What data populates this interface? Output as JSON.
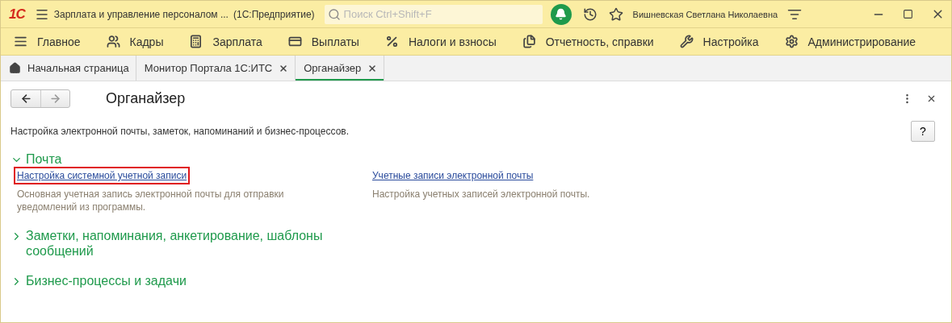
{
  "window": {
    "logo": "1С",
    "title": "Зарплата и управление персоналом ...",
    "subtitle": "(1С:Предприятие)",
    "search": {
      "placeholder": "Поиск Ctrl+Shift+F"
    },
    "user": "Вишневская Светлана Николаевна"
  },
  "sections": [
    {
      "label": "Главное"
    },
    {
      "label": "Кадры"
    },
    {
      "label": "Зарплата"
    },
    {
      "label": "Выплаты"
    },
    {
      "label": "Налоги и взносы"
    },
    {
      "label": "Отчетность, справки"
    },
    {
      "label": "Настройка"
    },
    {
      "label": "Администрирование"
    }
  ],
  "tabs": [
    {
      "label": "Начальная страница",
      "selected": false,
      "closable": false
    },
    {
      "label": "Монитор Портала 1С:ИТС",
      "selected": false,
      "closable": true
    },
    {
      "label": "Органайзер",
      "selected": true,
      "closable": true
    }
  ],
  "form": {
    "title": "Органайзер",
    "description": "Настройка электронной почты, заметок, напоминаний и бизнес-процессов.",
    "help": "?",
    "groups": [
      {
        "title": "Почта",
        "expanded": true,
        "links": [
          {
            "label": "Настройка системной учетной записи",
            "description": "Основная учетная запись электронной почты для отправки уведомлений из программы.",
            "highlighted": true
          },
          {
            "label": "Учетные записи электронной почты",
            "description": "Настройка учетных записей электронной почты.",
            "highlighted": false
          }
        ]
      },
      {
        "title": "Заметки, напоминания, анкетирование, шаблоны сообщений",
        "expanded": false
      },
      {
        "title": "Бизнес-процессы и задачи",
        "expanded": false
      }
    ]
  }
}
